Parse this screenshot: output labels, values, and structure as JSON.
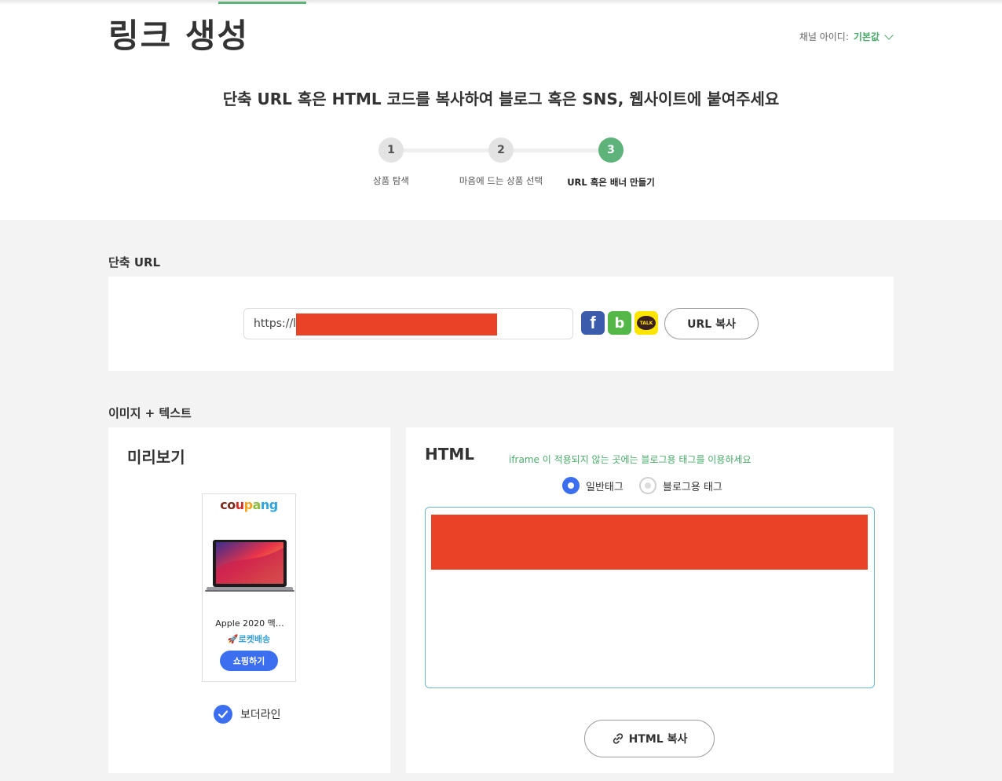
{
  "page": {
    "title": "링크 생성"
  },
  "channel": {
    "label": "채널 아이디:",
    "value": "기본값"
  },
  "subtitle": "단축 URL 혹은 HTML 코드를 복사하여 블로그 혹은 SNS, 웹사이트에 붙여주세요",
  "steps": [
    {
      "num": "1",
      "label": "상품 탐색"
    },
    {
      "num": "2",
      "label": "마음에 드는 상품 선택"
    },
    {
      "num": "3",
      "label": "URL 혹은 배너 만들기"
    }
  ],
  "short_url": {
    "section_title": "단축 URL",
    "value": "https://li",
    "copy_label": "URL 복사",
    "share": {
      "facebook": "facebook-icon",
      "band": "band-icon",
      "kakaotalk": "kakaotalk-icon",
      "talk_text": "TALK"
    }
  },
  "image_text": {
    "section_title": "이미지 + 텍스트"
  },
  "preview": {
    "title": "미리보기",
    "logo": "coupang",
    "product_name": "Apple 2020 맥…",
    "delivery": "🚀로켓배송",
    "shop_button": "쇼핑하기",
    "border_option": "보더라인"
  },
  "html_panel": {
    "title": "HTML",
    "hint": "iframe 이 적용되지 않는 곳에는 블로그용 태그를 이용하세요",
    "radio_general": "일반태그",
    "radio_blog": "블로그용 태그",
    "copy_label": "HTML 복사"
  },
  "colors": {
    "accent_green": "#5eb37a",
    "accent_blue": "#3b6ff0",
    "redaction": "#e84327"
  }
}
